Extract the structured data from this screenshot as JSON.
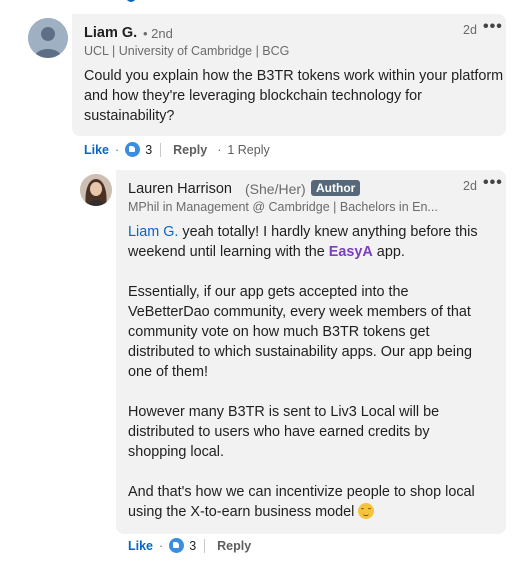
{
  "comment": {
    "author_name": "Liam G.",
    "degree": "• 2nd",
    "headline": "UCL | University of Cambridge | BCG",
    "time": "2d",
    "more_icon": "ellipsis-icon",
    "text": "Could you explain how the B3TR tokens work within your platform and how they're leveraging blockchain technology for sustainability?",
    "actions": {
      "like": "Like",
      "dot": "·",
      "reaction_icon": "like-reaction-icon",
      "reaction_count": "3",
      "reply": "Reply",
      "replies_count": "1 Reply"
    }
  },
  "reply": {
    "author_name": "Lauren Harrison",
    "pronouns": "(She/Her)",
    "badge": "Author",
    "headline": "MPhil in Management @ Cambridge | Bachelors in En...",
    "time": "2d",
    "more_icon": "ellipsis-icon",
    "mention": "Liam G.",
    "p1_a": " yeah totally! I hardly knew anything before this weekend until learning with the ",
    "company": "EasyA",
    "p1_b": " app.",
    "p2": "Essentially, if our app gets accepted into the VeBetterDao community, every week members of that community vote on how much B3TR tokens get distributed to which sustainability apps. Our app being one of them!",
    "p3": "However many B3TR is sent to Liv3 Local will be distributed to users who have earned credits by shopping local.",
    "p4": "And that's how we can incentivize people to shop local using the X-to-earn business model ",
    "emoji_icon": "upside-down-face-emoji-icon",
    "actions": {
      "like": "Like",
      "dot": "·",
      "reaction_icon": "like-reaction-icon",
      "reaction_count": "3",
      "reply": "Reply"
    }
  }
}
